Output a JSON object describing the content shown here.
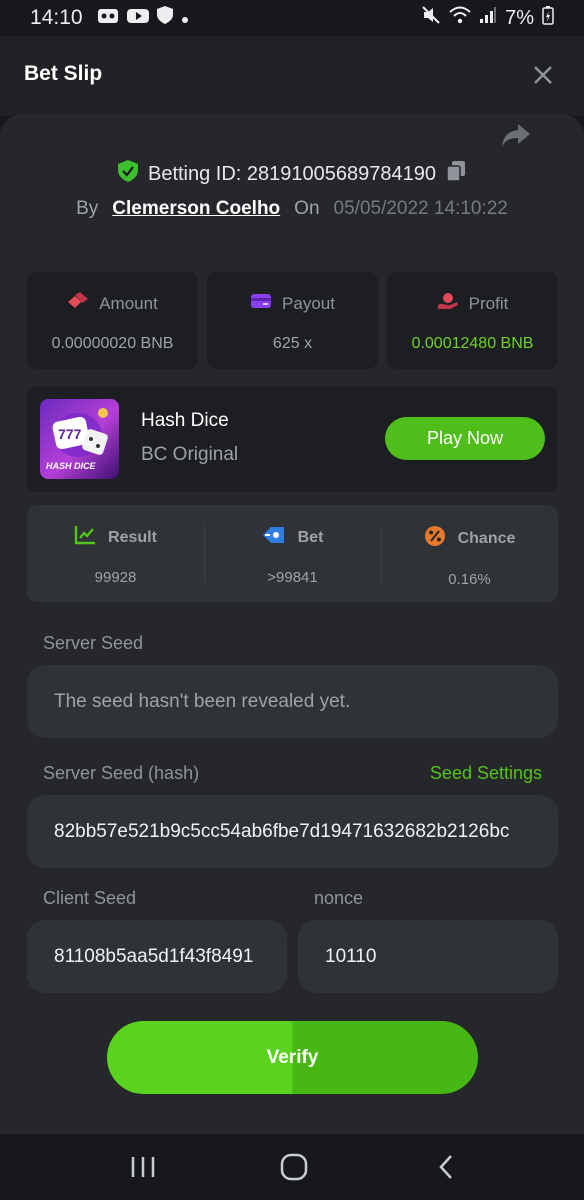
{
  "status_bar": {
    "time": "14:10",
    "battery": "7%",
    "icons": [
      "voicemail-icon",
      "youtube-icon",
      "shield-icon",
      "dot-icon",
      "mute-icon",
      "wifi-icon",
      "signal-icon",
      "battery-icon"
    ]
  },
  "header": {
    "title": "Bet Slip",
    "close_icon": "close-icon"
  },
  "bet_info": {
    "betting_id_label": "Betting ID: 28191005689784190",
    "by_label": "By",
    "user": "Clemerson Coelho",
    "on_label": "On",
    "date": "05/05/2022 14:10:22"
  },
  "stats": {
    "amount": {
      "label": "Amount",
      "value": "0.00000020 BNB"
    },
    "payout": {
      "label": "Payout",
      "value": "625 x"
    },
    "profit": {
      "label": "Profit",
      "value": "0.00012480 BNB"
    }
  },
  "game": {
    "thumb_text": "HASH DICE",
    "name": "Hash Dice",
    "subtitle": "BC Original",
    "play_label": "Play Now"
  },
  "result": {
    "result": {
      "label": "Result",
      "value": "99928"
    },
    "bet": {
      "label": "Bet",
      "value": ">99841"
    },
    "chance": {
      "label": "Chance",
      "value": "0.16%"
    }
  },
  "seeds": {
    "server_seed_label": "Server Seed",
    "server_seed_value": "The seed hasn't been revealed yet.",
    "server_hash_label": "Server Seed (hash)",
    "seed_settings_label": "Seed Settings",
    "server_hash_value": "82bb57e521b9c5cc54ab6fbe7d19471632682b2126bc",
    "client_seed_label": "Client Seed",
    "client_seed_value": "81108b5aa5d1f43f8491",
    "nonce_label": "nonce",
    "nonce_value": "10110"
  },
  "verify_label": "Verify",
  "colors": {
    "accent_green": "#4fbe1a",
    "profit_green": "#6fd12a",
    "background": "#17181b",
    "panel": "#25272b"
  }
}
